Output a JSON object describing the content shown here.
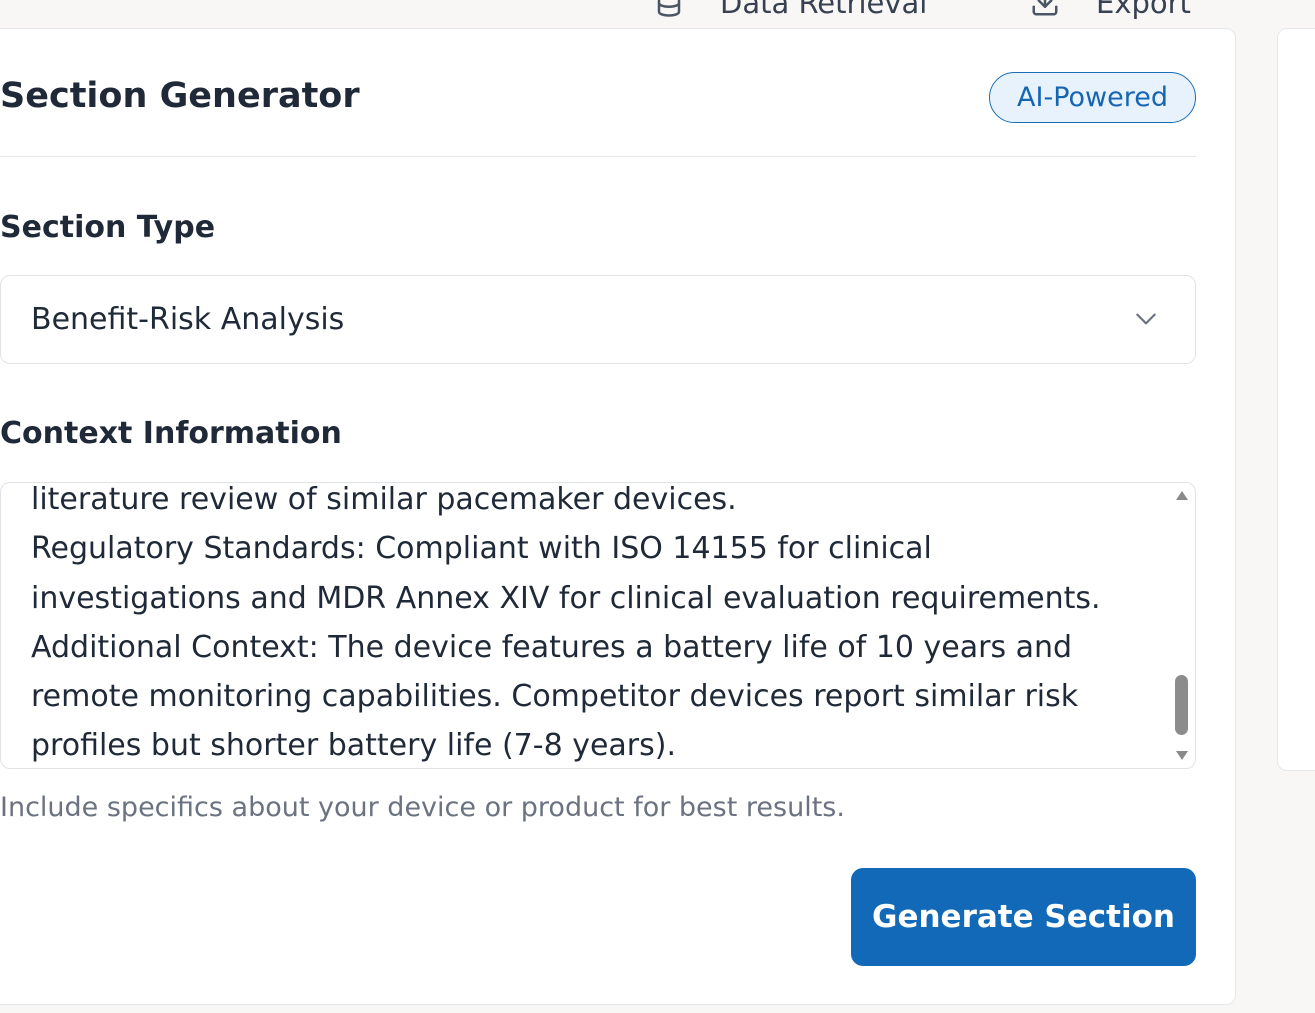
{
  "topbar": {
    "items": [
      {
        "label": "Data Retrieval",
        "icon": "database-icon"
      },
      {
        "label": "Export",
        "icon": "download-icon"
      }
    ]
  },
  "generator": {
    "title": "Section Generator",
    "badge": "AI-Powered",
    "section_type": {
      "label": "Section Type",
      "selected": "Benefit-Risk Analysis"
    },
    "context": {
      "label": "Context Information",
      "lines": [
        "literature review of similar pacemaker devices.",
        "Regulatory Standards: Compliant with ISO 14155 for clinical",
        "investigations and MDR Annex XIV for clinical evaluation requirements.",
        "Additional Context: The device features a battery life of 10 years and",
        "remote monitoring capabilities. Competitor devices report similar risk",
        "profiles but shorter battery life (7-8 years)."
      ],
      "helper": "Include specifics about your device or product for best results."
    },
    "generate_button": "Generate Section"
  },
  "colors": {
    "accent": "#1269b8",
    "badge_bg": "#e8f2fc",
    "page_bg": "#f8f7f5"
  }
}
